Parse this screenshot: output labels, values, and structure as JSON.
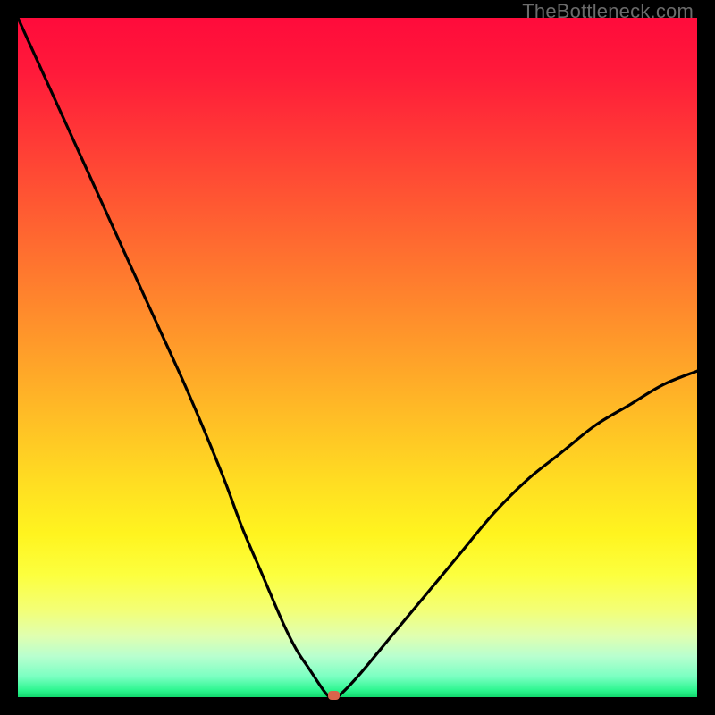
{
  "watermark": "TheBottleneck.com",
  "colors": {
    "frame": "#000000",
    "curve": "#000000",
    "marker": "#d9644b"
  },
  "chart_data": {
    "type": "line",
    "title": "",
    "xlabel": "",
    "ylabel": "",
    "xlim": [
      0,
      100
    ],
    "ylim": [
      0,
      100
    ],
    "grid": false,
    "legend": false,
    "x": [
      0,
      5,
      10,
      15,
      20,
      25,
      30,
      33,
      36,
      39,
      41,
      43,
      45,
      46,
      47,
      50,
      55,
      60,
      65,
      70,
      75,
      80,
      85,
      90,
      95,
      100
    ],
    "values": [
      100,
      89,
      78,
      67,
      56,
      45,
      33,
      25,
      18,
      11,
      7,
      4,
      1,
      0,
      0,
      3,
      9,
      15,
      21,
      27,
      32,
      36,
      40,
      43,
      46,
      48
    ],
    "minimum": {
      "x": 46.5,
      "y": 0
    },
    "note": "V-shaped bottleneck curve on vertical rainbow heat gradient; minimum near x≈46 at y=0."
  }
}
